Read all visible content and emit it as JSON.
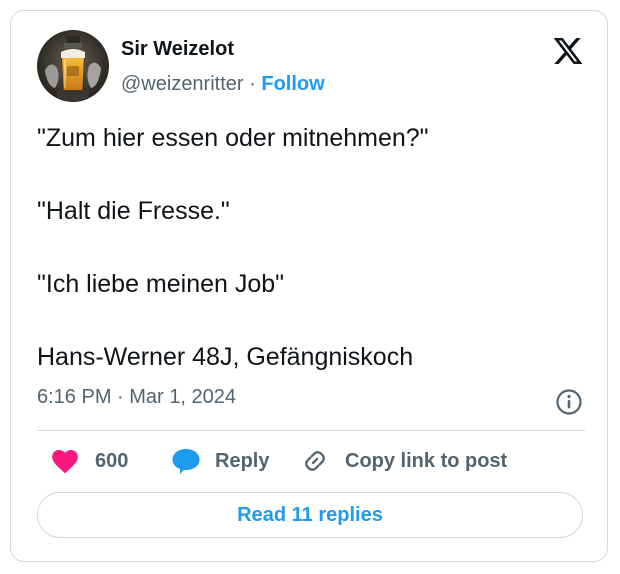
{
  "author": {
    "display_name": "Sir Weizelot",
    "handle": "@weizenritter",
    "separator": "·",
    "follow_label": "Follow",
    "avatar_icon": "beer-glass-avatar-icon"
  },
  "platform_icon": "x-logo-icon",
  "tweet": {
    "lines": [
      "\"Zum hier essen oder mitnehmen?\"",
      "\"Halt die Fresse.\"",
      "\"Ich liebe meinen Job\"",
      "Hans-Werner 48J, Gefängniskoch"
    ],
    "timestamp": "6:16 PM · Mar 1, 2024"
  },
  "actions": {
    "like_count": "600",
    "reply_label": "Reply",
    "copy_label": "Copy link to post"
  },
  "read_replies_label": "Read 11 replies",
  "colors": {
    "accent": "#1d9bf0",
    "like": "#f91880",
    "text": "#0f1419",
    "muted": "#536471",
    "border": "#cfd9de"
  }
}
